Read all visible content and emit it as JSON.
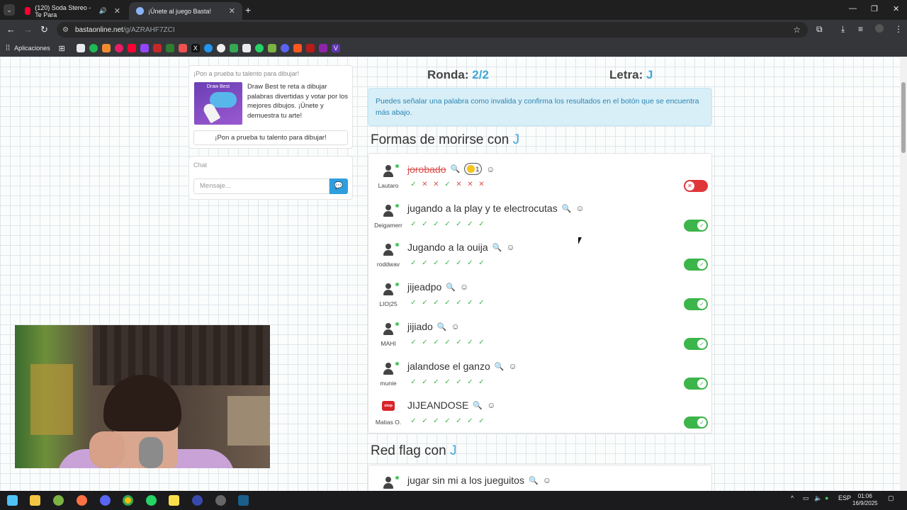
{
  "browser": {
    "tabs": [
      {
        "label": "(120) Soda Stereo - Te Para",
        "active": false
      },
      {
        "label": "¡Únete al juego Basta!",
        "active": true
      }
    ],
    "url_host": "bastaonline.net",
    "url_path": "/g/AZRAHF7ZCI",
    "bookmarks_label": "Aplicaciones"
  },
  "promo": {
    "title": "¡Pon a prueba tu talento para dibujar!",
    "image_label": "Draw Best",
    "description": "Draw Best te reta a dibujar palabras divertidas y votar por los mejores dibujos. ¡Únete y demuestra tu arte!",
    "button": "¡Pon a prueba tu talento para dibujar!"
  },
  "chat": {
    "title": "Chat",
    "placeholder": "Mensaje..."
  },
  "game": {
    "round_label": "Ronda:",
    "round_value": "2/2",
    "letter_label": "Letra:",
    "letter_value": "J",
    "info": "Puedes señalar una palabra como invalida y confirma los resultados en el botón que se encuentra más abajo."
  },
  "categories": [
    {
      "title": "Formas de morirse con",
      "letter": "J",
      "answers": [
        {
          "user": "Lautaro",
          "word": "jorobado",
          "invalid": true,
          "reaction_count": "1",
          "votes": [
            "ok",
            "no",
            "no",
            "ok",
            "no",
            "no",
            "no"
          ],
          "valid": false
        },
        {
          "user": "Deigamerr",
          "word": "jugando a la play y te electrocutas",
          "invalid": false,
          "votes": [
            "ok",
            "ok",
            "ok",
            "ok",
            "ok",
            "ok",
            "ok"
          ],
          "valid": true
        },
        {
          "user": "roddwav",
          "word": "Jugando a la ouija",
          "invalid": false,
          "votes": [
            "ok",
            "ok",
            "ok",
            "ok",
            "ok",
            "ok",
            "ok"
          ],
          "valid": true
        },
        {
          "user": "LIO|25",
          "word": "jijeadpo",
          "invalid": false,
          "votes": [
            "ok",
            "ok",
            "ok",
            "ok",
            "ok",
            "ok",
            "ok"
          ],
          "valid": true
        },
        {
          "user": "MAHI",
          "word": "jijiado",
          "invalid": false,
          "votes": [
            "ok",
            "ok",
            "ok",
            "ok",
            "ok",
            "ok",
            "ok"
          ],
          "valid": true
        },
        {
          "user": "munie",
          "word": "jalandose el ganzo",
          "invalid": false,
          "votes": [
            "ok",
            "ok",
            "ok",
            "ok",
            "ok",
            "ok",
            "ok"
          ],
          "valid": true
        },
        {
          "user": "Matias O.",
          "word": "JIJEANDOSE",
          "invalid": false,
          "stop_badge": "stop",
          "votes": [
            "ok",
            "ok",
            "ok",
            "ok",
            "ok",
            "ok",
            "ok"
          ],
          "valid": true
        }
      ]
    },
    {
      "title": "Red flag con",
      "letter": "J",
      "answers": [
        {
          "user": "",
          "word": "jugar sin mi a los jueguitos",
          "invalid": false,
          "votes": [],
          "valid": true
        }
      ]
    }
  ],
  "taskbar": {
    "lang": "ESP",
    "time": "01:06",
    "date": "16/9/2025"
  },
  "colors": {
    "accent": "#3fa7dc",
    "valid": "#3cb54a",
    "invalid": "#e0363a"
  }
}
